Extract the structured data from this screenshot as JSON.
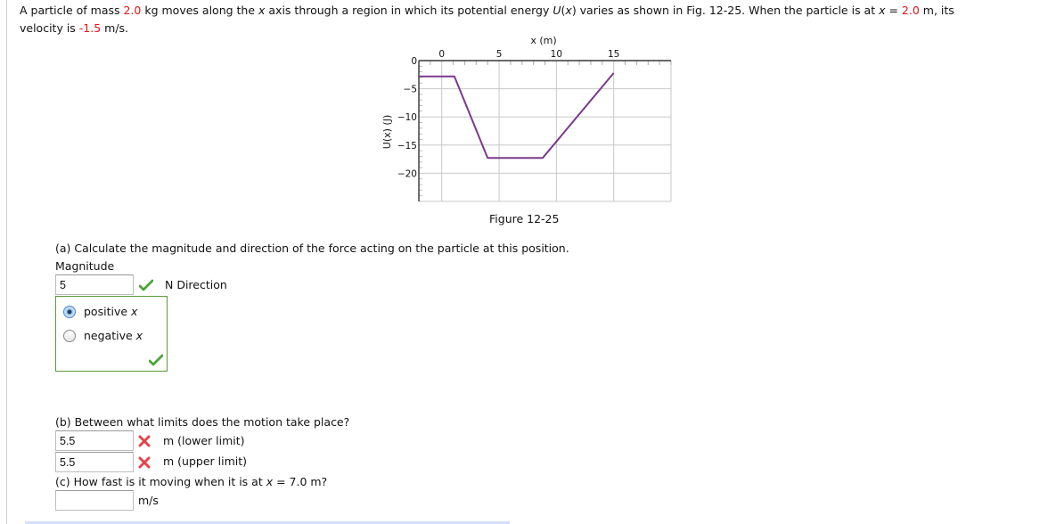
{
  "problem": {
    "intro_parts": [
      "A particle of mass ",
      "2.0",
      " kg moves along the ",
      "x",
      " axis through a region in which its potential energy ",
      "U",
      "(",
      "x",
      ") varies as shown in Fig. 12-25. When the particle is at ",
      "x",
      " = ",
      "2.0",
      " m, its"
    ],
    "intro_line2": [
      "velocity is ",
      "-1.5",
      " m/s."
    ],
    "mass": "2.0",
    "position": "2.0",
    "velocity": "-1.5",
    "highlight_color": "#ee1111"
  },
  "figure": {
    "caption": "Figure 12-25"
  },
  "chart_data": {
    "type": "line",
    "title": "",
    "xlabel": "x (m)",
    "ylabel": "U(x) (J)",
    "xlim": [
      -2,
      20
    ],
    "ylim": [
      -25,
      0
    ],
    "x_ticks": [
      0,
      5,
      10,
      15
    ],
    "x_tick_labels": [
      "0",
      "5",
      "10",
      "15"
    ],
    "y_ticks": [
      0,
      -5,
      -10,
      -15,
      -20
    ],
    "y_tick_labels": [
      "0",
      "-5",
      "-10",
      "-15",
      "-20"
    ],
    "x_axis_position": "top",
    "grid": true,
    "legend": "none",
    "series": [
      {
        "name": "U(x)",
        "color": "#7a3a8c",
        "x": [
          -2,
          1.1,
          4.0,
          8.8,
          15
        ],
        "y": [
          -2.8,
          -2.8,
          -17.3,
          -17.3,
          -2.2
        ]
      }
    ]
  },
  "part_a": {
    "question": "(a) Calculate the magnitude and direction of the force acting on the particle at this position.",
    "magnitude_label": "Magnitude",
    "magnitude_value": "5",
    "magnitude_status": "correct",
    "unit_direction_label": "N Direction",
    "options": [
      {
        "label": "positive ",
        "var": "x",
        "selected": true
      },
      {
        "label": "negative ",
        "var": "x",
        "selected": false
      }
    ],
    "direction_status": "correct"
  },
  "part_b": {
    "question": "(b) Between what limits does the motion take place?",
    "lower_value": "5.5",
    "lower_status": "incorrect",
    "lower_label": "m (lower limit)",
    "upper_value": "5.5",
    "upper_status": "incorrect",
    "upper_label": "m (upper limit)"
  },
  "part_c": {
    "question_parts": [
      "(c) How fast is it moving when it is at ",
      "x",
      " = 7.0 m?"
    ],
    "value": "",
    "unit": "m/s"
  },
  "colors": {
    "correct": "#4ea43a",
    "incorrect": "#e0454a",
    "box_border": "#5a9a3a"
  }
}
